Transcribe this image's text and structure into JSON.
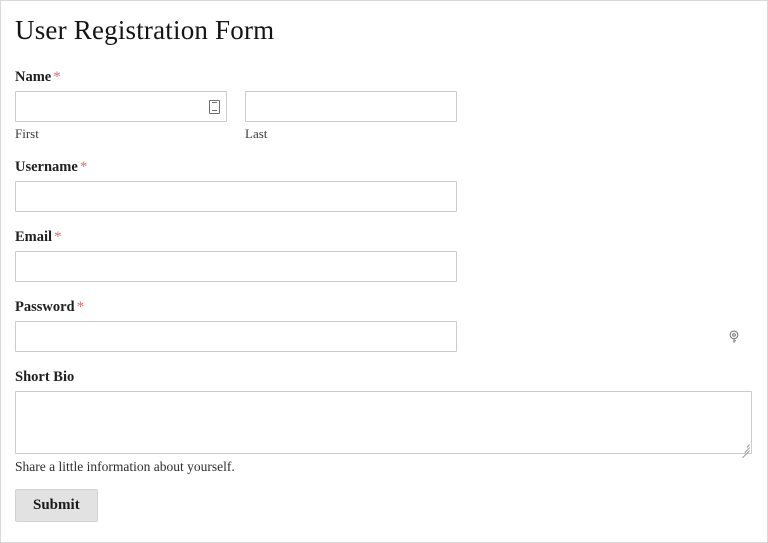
{
  "form": {
    "title": "User Registration Form",
    "required_marker": "*",
    "accent_required_color": "#e06a6a",
    "border_color": "#cbcbcb",
    "button_bg_color": "#e2e2e2",
    "fields": {
      "name": {
        "label": "Name",
        "required": true,
        "first": {
          "value": "",
          "placeholder": "",
          "sub_label": "First",
          "icon": "contact-card-autofill-icon"
        },
        "last": {
          "value": "",
          "placeholder": "",
          "sub_label": "Last"
        }
      },
      "username": {
        "label": "Username",
        "required": true,
        "value": "",
        "placeholder": ""
      },
      "email": {
        "label": "Email",
        "required": true,
        "value": "",
        "placeholder": ""
      },
      "password": {
        "label": "Password",
        "required": true,
        "value": "",
        "placeholder": "",
        "icon": "key-icon"
      },
      "short_bio": {
        "label": "Short Bio",
        "required": false,
        "value": "",
        "placeholder": "",
        "help_text": "Share a little information about yourself."
      }
    },
    "submit_label": "Submit"
  }
}
